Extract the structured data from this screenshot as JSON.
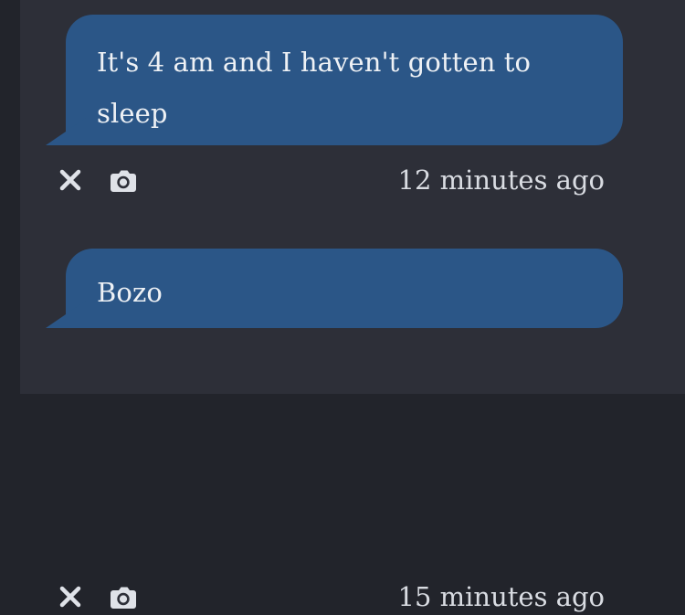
{
  "messages": [
    {
      "text": "It's 4 am and I haven't gotten to sleep",
      "timestamp": "12 minutes ago",
      "actions": {
        "close_icon": "close-icon",
        "camera_icon": "camera-icon"
      }
    },
    {
      "text": "Bozo",
      "timestamp": "15 minutes ago",
      "actions": {
        "close_icon": "close-icon",
        "camera_icon": "camera-icon"
      }
    }
  ],
  "colors": {
    "background": "#22242b",
    "panel": "#2d2f38",
    "bubble": "#2b5687",
    "text": "#eef1f5",
    "meta_text": "#d9dce2",
    "icon": "#dfe2e8"
  }
}
